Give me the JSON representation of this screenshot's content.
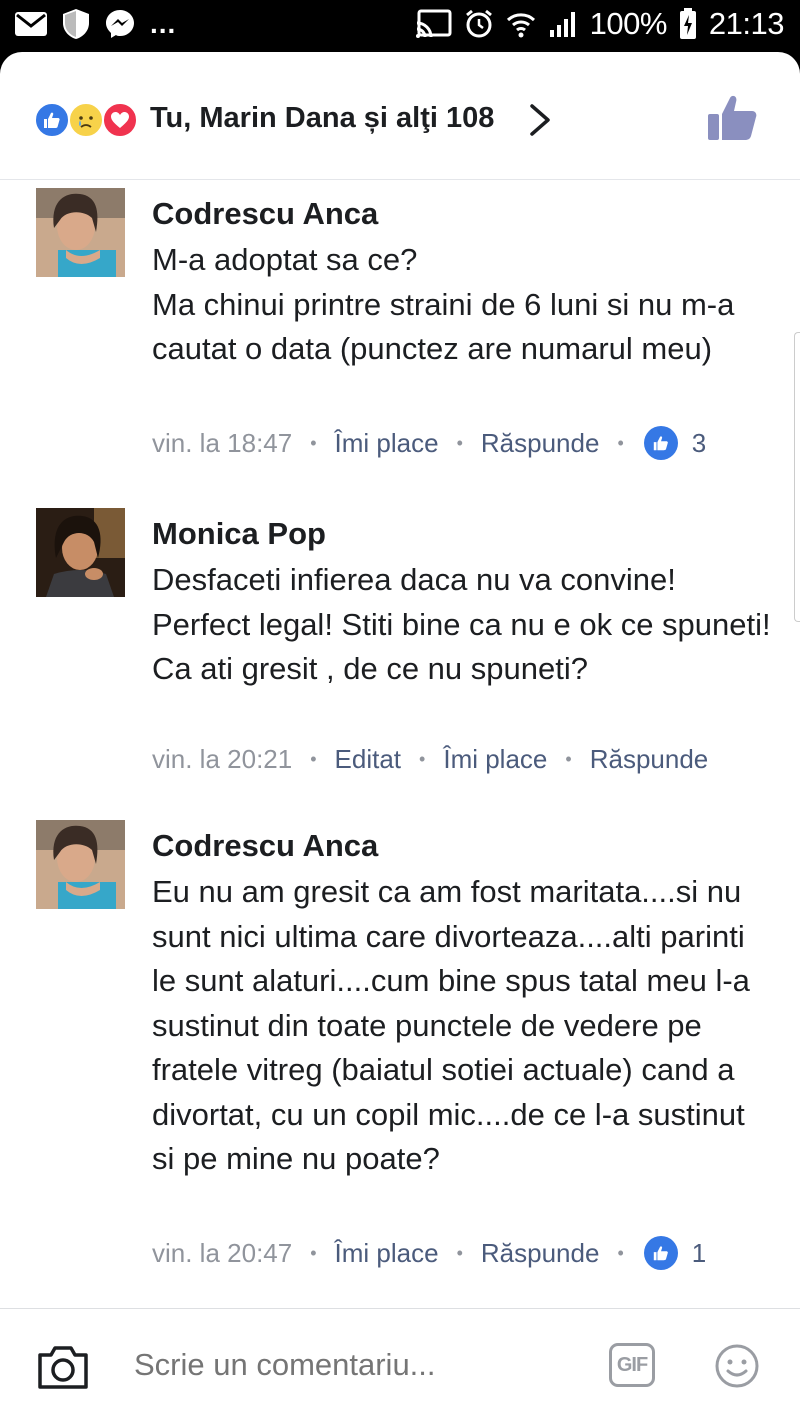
{
  "status_bar": {
    "left_icons": [
      "mail-icon",
      "shield-icon",
      "messenger-icon"
    ],
    "more": "...",
    "battery": "100%",
    "time": "21:13"
  },
  "reactions": {
    "icons": [
      "like",
      "sad",
      "love"
    ],
    "summary": "Tu, Marin Dana și alţi 108"
  },
  "comments": [
    {
      "author": "Codrescu Anca",
      "text": "M-a adoptat sa ce?\nMa chinui printre straini de 6 luni si nu m-a cautat o data (punctez are numarul meu)",
      "time": "vin. la 18:47",
      "like_label": "Îmi place",
      "reply_label": "Răspunde",
      "likes": "3"
    },
    {
      "author": "Monica Pop",
      "text": "Desfaceti infierea daca nu  va convine! Perfect legal! Stiti bine ca nu e ok ce spuneti! Ca ati gresit , de  ce nu spuneti?",
      "time": "vin. la 20:21",
      "edited_label": "Editat",
      "like_label": "Îmi place",
      "reply_label": "Răspunde"
    },
    {
      "author": "Codrescu Anca",
      "text": "Eu nu am gresit ca am fost maritata....si nu sunt nici ultima care divorteaza....alti parinti le sunt alaturi....cum bine spus tatal meu l-a sustinut din toate punctele de vedere pe fratele vitreg (baiatul sotiei actuale) cand a divortat, cu un copil mic....de ce l-a sustinut si pe mine nu poate?",
      "time": "vin. la 20:47",
      "like_label": "Îmi place",
      "reply_label": "Răspunde",
      "likes": "1"
    }
  ],
  "composer": {
    "placeholder": "Scrie un comentariu...",
    "gif_label": "GIF"
  },
  "colors": {
    "facebook_blue": "#3578e5",
    "like_button": "#8a8fbf",
    "meta_gray": "#90949c",
    "action_blue_gray": "#4b5b7c"
  }
}
